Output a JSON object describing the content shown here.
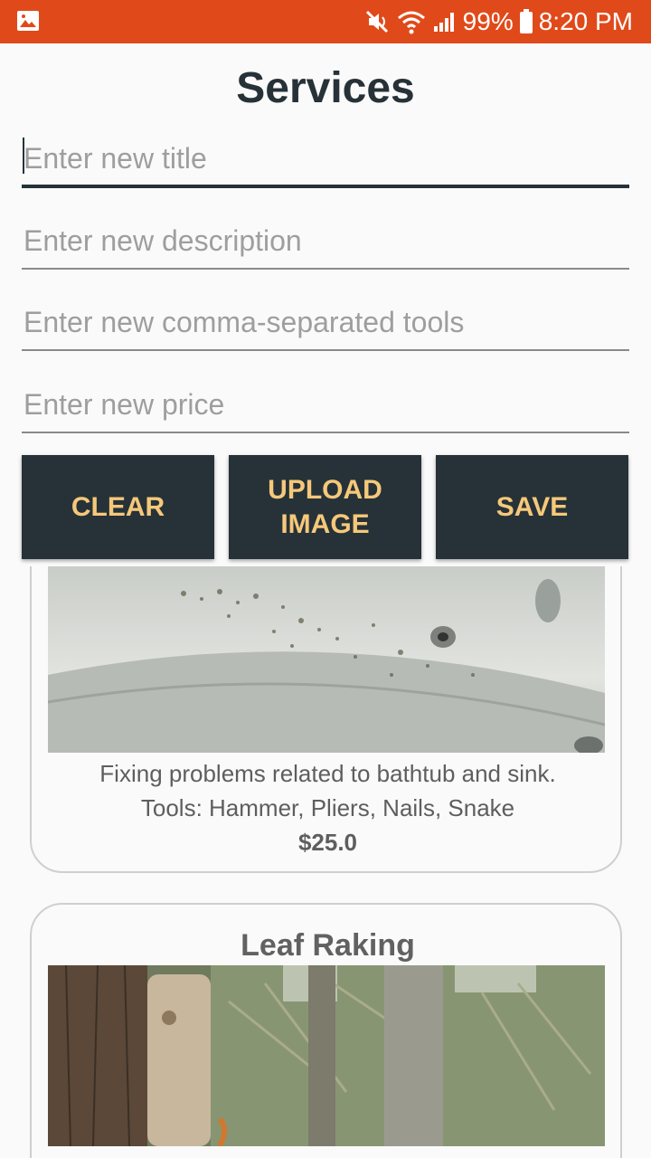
{
  "status_bar": {
    "battery": "99%",
    "time": "8:20 PM"
  },
  "page": {
    "title": "Services"
  },
  "form": {
    "title_placeholder": "Enter new title",
    "description_placeholder": "Enter new description",
    "tools_placeholder": "Enter new comma-separated tools",
    "price_placeholder": "Enter new price"
  },
  "buttons": {
    "clear": "CLEAR",
    "upload_line1": "UPLOAD",
    "upload_line2": "IMAGE",
    "save": "SAVE"
  },
  "services": [
    {
      "description": "Fixing problems related to bathtub and sink.",
      "tools": "Tools: Hammer, Pliers, Nails, Snake",
      "price": "$25.0"
    },
    {
      "title": "Leaf Raking"
    }
  ],
  "colors": {
    "status_bar": "#e04a1a",
    "primary_dark": "#263238",
    "button_text": "#f6c87a"
  }
}
